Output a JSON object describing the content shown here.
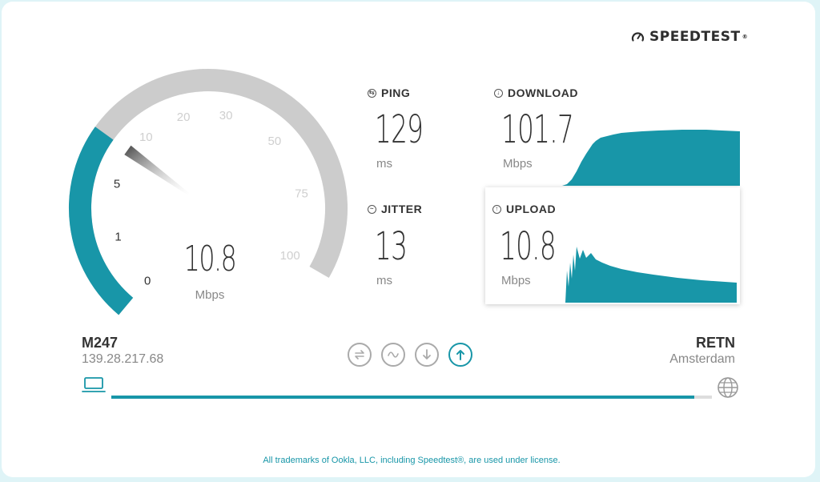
{
  "brand": {
    "name": "SPEEDTEST",
    "icon": "gauge-icon"
  },
  "gauge": {
    "value": "10.8",
    "unit": "Mbps",
    "ticks": [
      "0",
      "1",
      "5",
      "10",
      "20",
      "30",
      "50",
      "75",
      "100"
    ],
    "fill_fraction": 0.33
  },
  "ping": {
    "label": "PING",
    "value": "129",
    "unit": "ms"
  },
  "jitter": {
    "label": "JITTER",
    "value": "13",
    "unit": "ms"
  },
  "download": {
    "label": "DOWNLOAD",
    "value": "101.7",
    "unit": "Mbps"
  },
  "upload": {
    "label": "UPLOAD",
    "value": "10.8",
    "unit": "Mbps"
  },
  "client": {
    "isp": "M247",
    "ip": "139.28.217.68"
  },
  "server": {
    "name": "RETN",
    "location": "Amsterdam"
  },
  "progress": {
    "fraction": 0.97
  },
  "footer": "All trademarks of Ookla, LLC, including Speedtest®, are used under license.",
  "colors": {
    "accent": "#1896a8",
    "track": "#cccccc"
  }
}
